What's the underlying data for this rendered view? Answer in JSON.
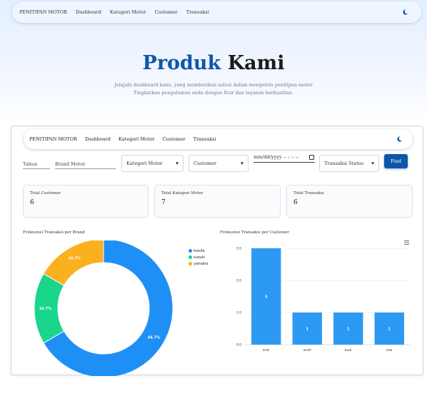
{
  "nav": {
    "brand": "PENITIPAN MOTOR",
    "links": [
      "Dashboard",
      "Kategori Motor",
      "Customer",
      "Transaksi"
    ]
  },
  "hero": {
    "title_highlight": "Produk",
    "title_rest": "Kami",
    "subtitle_line1": "Jelajahi dashboard kami, yang memberikan solusi dalam mengelola penitipan motor",
    "subtitle_line2": "Tingkatkan pengalaman anda dengan fitur dan layanan berkualitas."
  },
  "filters": {
    "tahun_placeholder": "Tahun",
    "brand_placeholder": "Brand Motor",
    "kategori_value": "Kategori Motor",
    "customer_value": "Customer",
    "date_placeholder": "mm/dd/yyyy -- : -- --",
    "status_value": "Transaksi Status",
    "find_label": "Find"
  },
  "stats": [
    {
      "label": "Total Customer",
      "value": "6"
    },
    {
      "label": "Total Kategori Motor",
      "value": "7"
    },
    {
      "label": "Total Transaksi",
      "value": "6"
    }
  ],
  "colors": {
    "primary": "#0d57a8",
    "honda": "#1e90f5",
    "suzuki": "#19d68c",
    "yamaha": "#fbb01f",
    "bar": "#2c9af2"
  },
  "chart_data": [
    {
      "type": "pie",
      "title": "Frekuensi Transaksi per Brand",
      "categories": [
        "honda",
        "suzuki",
        "yamaha"
      ],
      "values": [
        66.7,
        16.7,
        16.7
      ],
      "labels": [
        "66.7%",
        "16.7%",
        "16.7%"
      ],
      "legend": "right"
    },
    {
      "type": "bar",
      "title": "Frekuensi Transaksi per Customer",
      "categories": [
        "andi",
        "andri",
        "budi",
        "edo"
      ],
      "values": [
        3,
        1,
        1,
        1
      ],
      "yticks": [
        "0.0",
        "1.0",
        "2.0",
        "3.0"
      ],
      "ylim": [
        0,
        3
      ],
      "grid": true
    }
  ]
}
